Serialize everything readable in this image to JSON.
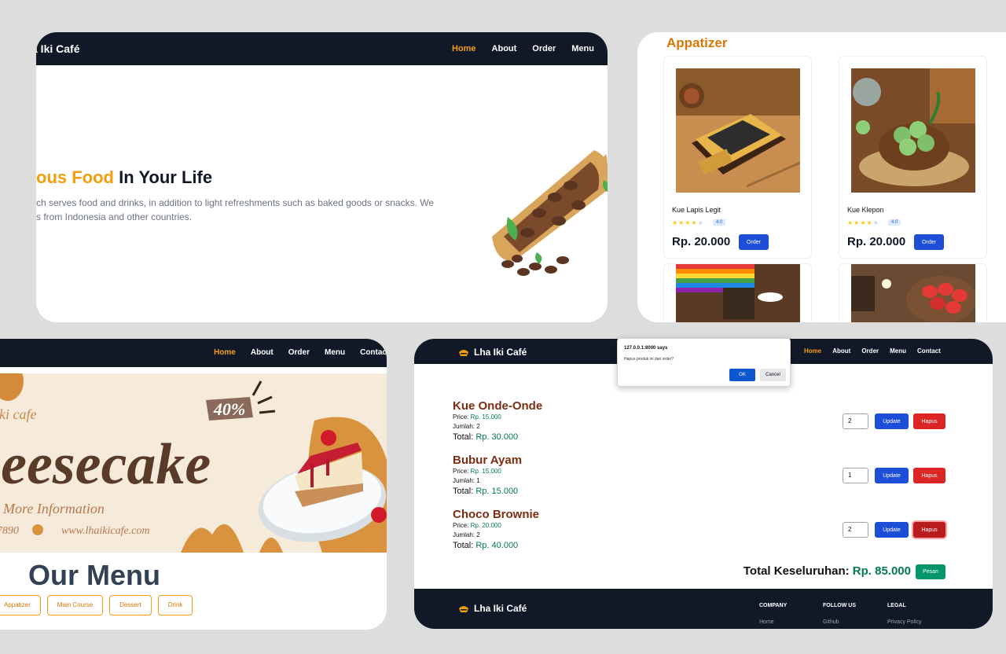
{
  "hero": {
    "brand": "a Iki Café",
    "nav": [
      "Home",
      "About",
      "Order",
      "Menu"
    ],
    "headline_accent": "ous Food",
    "headline_rest": " In Your Life",
    "desc_line1": "ch serves food and drinks, in addition to light refreshments such as baked goods or snacks. We",
    "desc_line2": "s from Indonesia and other countries."
  },
  "appetizer": {
    "title": "Appatizer",
    "cards": [
      {
        "name": "Kue Lapis Legit",
        "rating": "4.0",
        "price": "Rp. 20.000",
        "order": "Order"
      },
      {
        "name": "Kue Klepon",
        "rating": "4.0",
        "price": "Rp. 20.000",
        "order": "Order"
      }
    ]
  },
  "menu": {
    "nav": [
      "Home",
      "About",
      "Order",
      "Menu",
      "Contac"
    ],
    "banner_brand": "iki cafe",
    "banner_discount": "40%",
    "banner_title": "heesecake",
    "banner_more": "More Information",
    "banner_phone": "7890",
    "banner_web": "www.lhaikicafe.com",
    "title": "Our Menu",
    "filters": [
      "Appatizer",
      "Main Course",
      "Dessert",
      "Drink"
    ]
  },
  "cart": {
    "brand": "Lha Iki Café",
    "nav": [
      "Home",
      "About",
      "Order",
      "Menu",
      "Contact"
    ],
    "price_label": "Price: ",
    "qty_label": "Jumlah: ",
    "total_label": "Total: ",
    "update_label": "Update",
    "delete_label": "Hapus",
    "items": [
      {
        "name": "Kue Onde-Onde",
        "price": "Rp. 15.000",
        "qty": "2",
        "total": "Rp. 30.000"
      },
      {
        "name": "Bubur Ayam",
        "price": "Rp. 15.000",
        "qty": "1",
        "total": "Rp. 15.000"
      },
      {
        "name": "Choco Brownie",
        "price": "Rp. 20.000",
        "qty": "2",
        "total": "Rp. 40.000"
      }
    ],
    "grand_label": "Total Keseluruhan: ",
    "grand_value": "Rp. 85.000",
    "pesan": "Pesan",
    "footer": {
      "brand": "Lha Iki Café",
      "cols": [
        {
          "head": "COMPANY",
          "link": "Home"
        },
        {
          "head": "FOLLOW US",
          "link": "Github"
        },
        {
          "head": "LEGAL",
          "link": "Privacy Policy"
        }
      ]
    }
  },
  "dialog": {
    "title": "127.0.0.1:8000 says",
    "message": "Hapus produk ini dari order?",
    "ok": "OK",
    "cancel": "Cancel"
  }
}
